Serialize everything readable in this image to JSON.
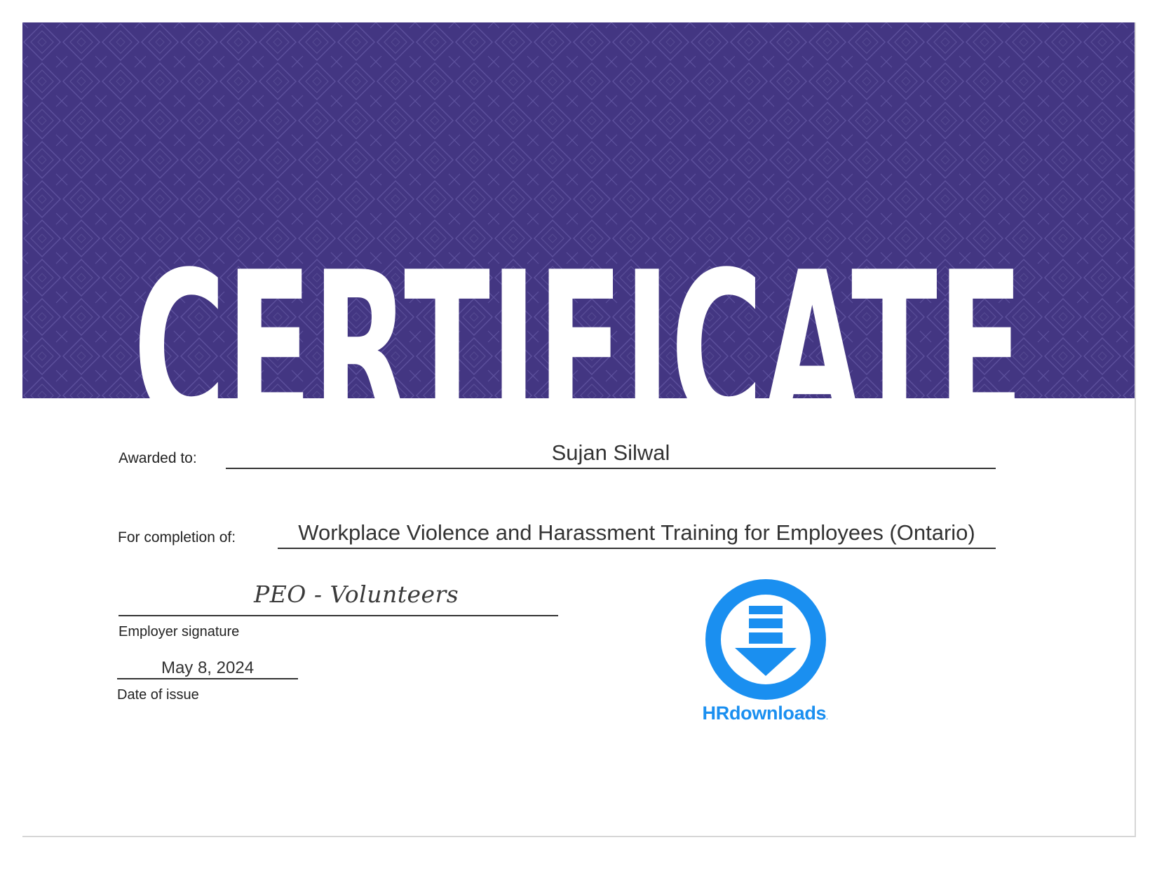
{
  "certificate": {
    "title": "CERTIFICATE",
    "awarded_label": "Awarded to:",
    "awarded_name": "Sujan Silwal",
    "completion_label": "For completion of:",
    "course_name": "Workplace Violence and Harassment Training for Employees (Ontario)",
    "signature_text": "PEO - Volunteers",
    "signature_label": "Employer signature",
    "issue_date": "May 8, 2024",
    "issue_date_label": "Date of issue"
  },
  "logo": {
    "name": "HRdownloads",
    "trademark": ".",
    "icon": "download-arrow-icon"
  },
  "colors": {
    "banner": "#433682",
    "pattern": "#6a5fa6",
    "title_text": "#ffffff",
    "logo_blue": "#1a8ff0"
  }
}
